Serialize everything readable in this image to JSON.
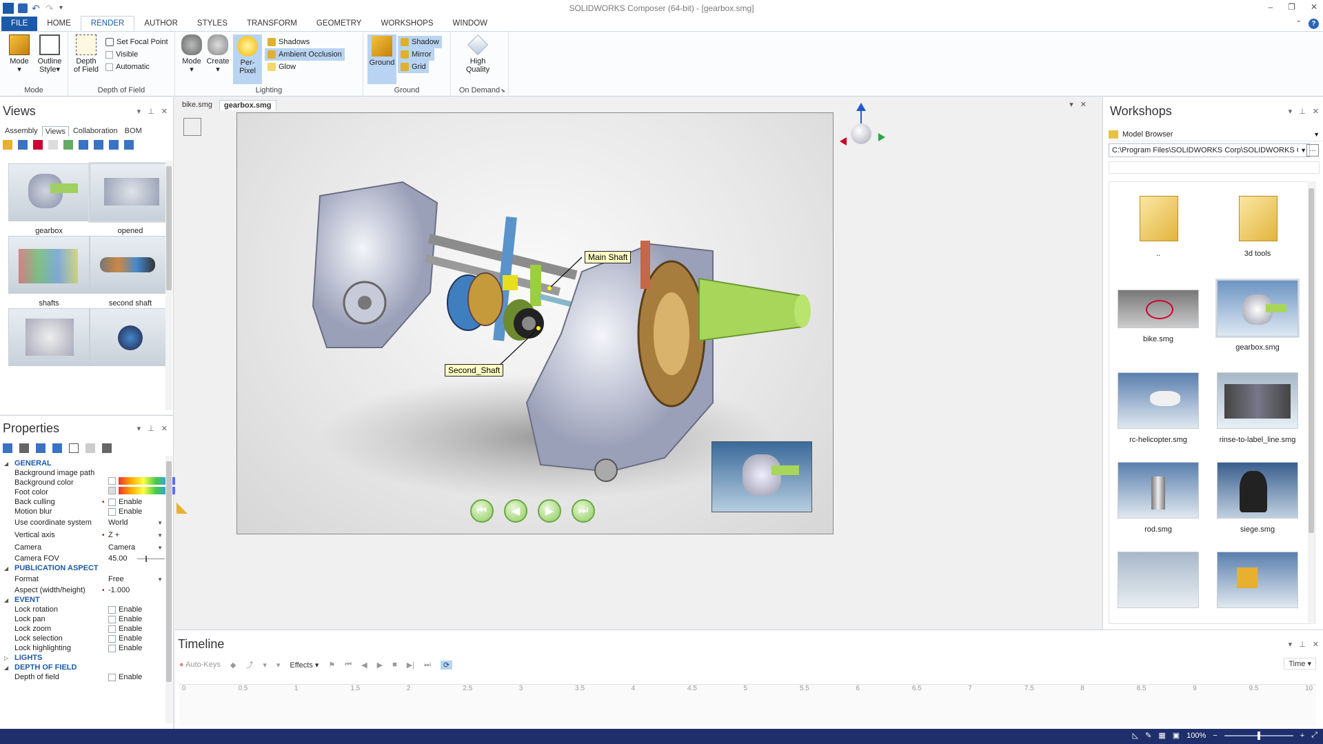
{
  "app": {
    "title": "SOLIDWORKS Composer (64-bit) - [gearbox.smg]",
    "logo_text": "3DS"
  },
  "menu": {
    "tabs": [
      "FILE",
      "HOME",
      "RENDER",
      "AUTHOR",
      "STYLES",
      "TRANSFORM",
      "GEOMETRY",
      "WORKSHOPS",
      "WINDOW"
    ],
    "active": "RENDER"
  },
  "ribbon": {
    "mode_group": {
      "label": "Mode",
      "mode": "Mode",
      "outline_style": "Outline Style"
    },
    "dof_group": {
      "label": "Depth of Field",
      "depth_of_field": "Depth of Field",
      "set_focal_point": "Set Focal Point",
      "visible": "Visible",
      "automatic": "Automatic"
    },
    "lighting_group": {
      "label": "Lighting",
      "mode": "Mode",
      "create": "Create",
      "per_pixel": "Per-Pixel",
      "shadows": "Shadows",
      "ambient_occlusion": "Ambient Occlusion",
      "glow": "Glow"
    },
    "ground_group": {
      "label": "Ground",
      "ground": "Ground",
      "shadow": "Shadow",
      "mirror": "Mirror",
      "grid": "Grid"
    },
    "ondemand_group": {
      "label": "On Demand",
      "high_quality": "High Quality"
    }
  },
  "views_panel": {
    "title": "Views",
    "tabs": [
      "Assembly",
      "Views",
      "Collaboration",
      "BOM"
    ],
    "active_tab": "Views",
    "items": [
      {
        "label": "gearbox"
      },
      {
        "label": "opened"
      },
      {
        "label": "shafts"
      },
      {
        "label": "second shaft"
      },
      {
        "label": ""
      },
      {
        "label": ""
      }
    ]
  },
  "properties_panel": {
    "title": "Properties",
    "rows": [
      {
        "kind": "section",
        "name": "GENERAL"
      },
      {
        "kind": "prop",
        "name": "Background image path",
        "value": ""
      },
      {
        "kind": "prop",
        "name": "Background color",
        "value": ""
      },
      {
        "kind": "prop",
        "name": "Foot color",
        "value": ""
      },
      {
        "kind": "prop",
        "name": "Back culling",
        "value": "Enable"
      },
      {
        "kind": "prop",
        "name": "Motion blur",
        "value": "Enable"
      },
      {
        "kind": "prop",
        "name": "Use coordinate system",
        "value": "World"
      },
      {
        "kind": "prop",
        "name": "Vertical axis",
        "value": "Z +"
      },
      {
        "kind": "prop",
        "name": "Camera",
        "value": "Camera"
      },
      {
        "kind": "prop",
        "name": "Camera FOV",
        "value": "45.00"
      },
      {
        "kind": "section",
        "name": "PUBLICATION ASPECT"
      },
      {
        "kind": "prop",
        "name": "Format",
        "value": "Free"
      },
      {
        "kind": "prop",
        "name": "Aspect (width/height)",
        "value": "-1.000"
      },
      {
        "kind": "section",
        "name": "EVENT"
      },
      {
        "kind": "prop",
        "name": "Lock rotation",
        "value": "Enable"
      },
      {
        "kind": "prop",
        "name": "Lock pan",
        "value": "Enable"
      },
      {
        "kind": "prop",
        "name": "Lock zoom",
        "value": "Enable"
      },
      {
        "kind": "prop",
        "name": "Lock selection",
        "value": "Enable"
      },
      {
        "kind": "prop",
        "name": "Lock highlighting",
        "value": "Enable"
      },
      {
        "kind": "section",
        "name": "LIGHTS"
      },
      {
        "kind": "section",
        "name": "DEPTH OF FIELD"
      },
      {
        "kind": "prop",
        "name": "Depth of field",
        "value": "Enable"
      }
    ]
  },
  "document": {
    "tabs": [
      "bike.smg",
      "gearbox.smg"
    ],
    "active_tab": "gearbox.smg",
    "callouts": {
      "main_shaft": "Main Shaft",
      "second_shaft": "Second_Shaft"
    }
  },
  "workshops": {
    "title": "Workshops",
    "browser": "Model Browser",
    "path": "C:\\Program Files\\SOLIDWORKS Corp\\SOLIDWORKS Con",
    "items": [
      {
        "label": ".."
      },
      {
        "label": "3d tools"
      },
      {
        "label": "bike.smg"
      },
      {
        "label": "gearbox.smg"
      },
      {
        "label": "rc-helicopter.smg"
      },
      {
        "label": "rinse-to-label_line.smg"
      },
      {
        "label": "rod.smg"
      },
      {
        "label": "siege.smg"
      }
    ]
  },
  "timeline": {
    "title": "Timeline",
    "auto_keys": "Auto-Keys",
    "effects": "Effects",
    "time_label": "Time",
    "ticks": [
      "0",
      "0.5",
      "1",
      "1.5",
      "2",
      "2.5",
      "3",
      "3.5",
      "4",
      "4.5",
      "5",
      "5.5",
      "6",
      "6.5",
      "7",
      "7.5",
      "8",
      "8.5",
      "9",
      "9.5",
      "10"
    ]
  },
  "status": {
    "zoom": "100%"
  },
  "colors": {
    "accent": "#1b5aa8",
    "statusbar": "#1f2f6c",
    "callout_bg": "#ffffc6"
  }
}
